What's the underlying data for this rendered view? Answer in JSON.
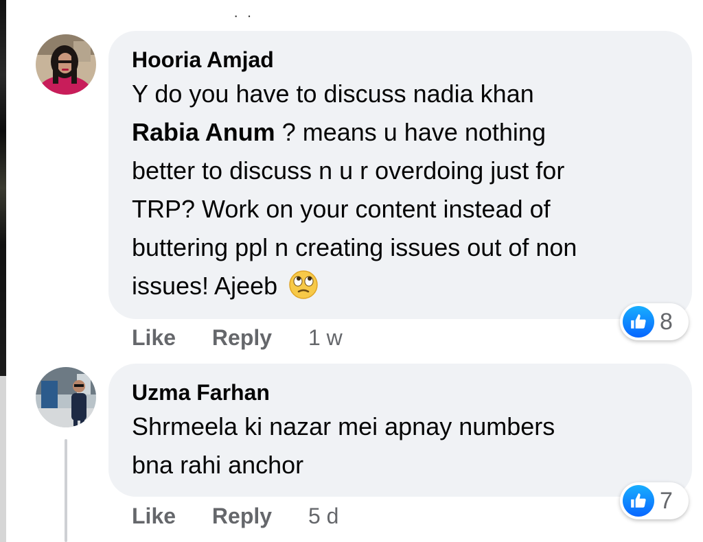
{
  "comments": [
    {
      "author": "Hooria Amjad",
      "text_lines": [
        "Y do you have to discuss nadia khan",
        "Rabia Anum",
        " ? means u have nothing",
        "better to discuss n u r overdoing just for",
        "TRP? Work on your content instead of",
        "buttering ppl n creating issues out of non",
        "issues! Ajeeb"
      ],
      "reaction_icon": "like-thumb-icon",
      "reaction_count": "8",
      "like_label": "Like",
      "reply_label": "Reply",
      "time": "1 w"
    },
    {
      "author": "Uzma Farhan",
      "text_lines": [
        "Shrmeela ki nazar mei apnay numbers",
        "bna rahi anchor"
      ],
      "reaction_icon": "like-thumb-icon",
      "reaction_count": "7",
      "like_label": "Like",
      "reply_label": "Reply",
      "time": "5 d"
    }
  ],
  "colors": {
    "bubble_bg": "#f0f2f5",
    "muted_text": "#65676b",
    "like_blue": "#0866ff"
  }
}
